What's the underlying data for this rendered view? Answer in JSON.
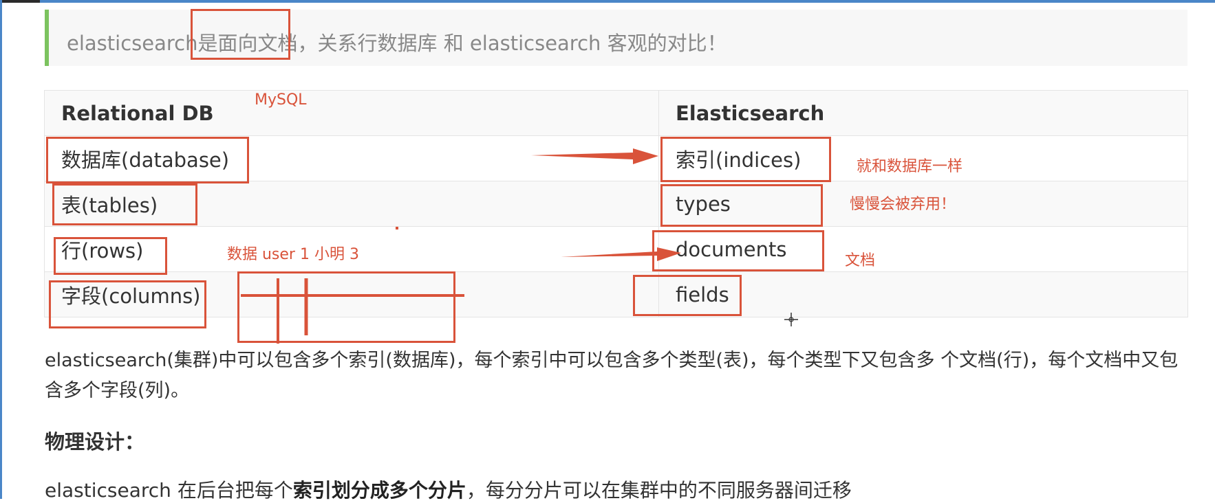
{
  "intro": {
    "prefix": "elasticsearch是",
    "highlight": "面向文档",
    "suffix": "，关系行数据库 和 elasticsearch 客观的对比！"
  },
  "table": {
    "headers": [
      "Relational DB",
      "Elasticsearch"
    ],
    "rows": [
      [
        "数据库(database)",
        "索引(indices)"
      ],
      [
        "表(tables)",
        "types"
      ],
      [
        "行(rows)",
        "documents"
      ],
      [
        "字段(columns)",
        "fields"
      ]
    ]
  },
  "annotations": {
    "mysql": "MySQL",
    "like_database": "就和数据库一样",
    "deprecated": "慢慢会被弃用！",
    "data_example": "数据 user 1  小明  3",
    "document": "文档"
  },
  "body": {
    "paragraph": "elasticsearch(集群)中可以包含多个索引(数据库)，每个索引中可以包含多个类型(表)，每个类型下又包含多 个文档(行)，每个文档中又包含多个字段(列)。",
    "heading": "物理设计：",
    "p2_prefix": "elasticsearch 在后台把每个",
    "p2_bold": "索引划分成多个分片",
    "p2_suffix": "，每分分片可以在集群中的不同服务器间迁移"
  },
  "colors": {
    "annotation": "#d9533a",
    "quote_bar": "#7cc35f",
    "window_border": "#4a86c8"
  }
}
